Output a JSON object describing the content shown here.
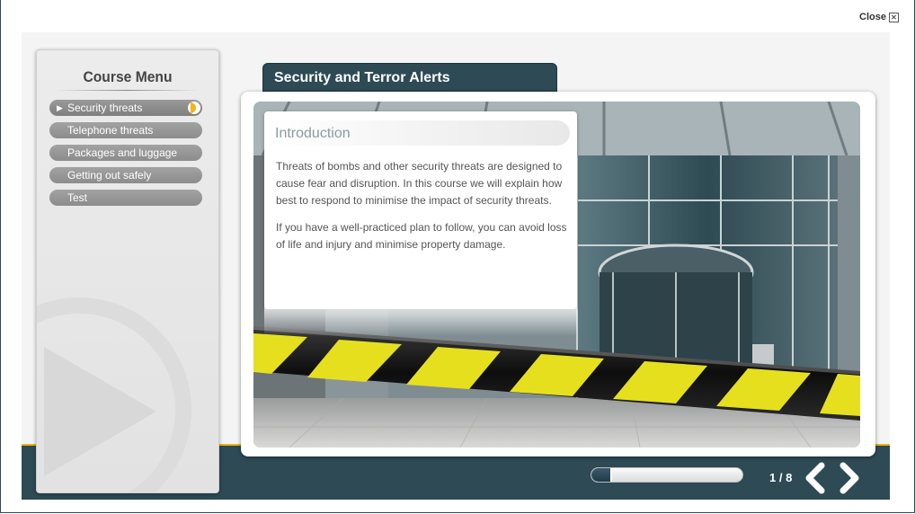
{
  "window": {
    "close_label": "Close"
  },
  "course_menu": {
    "title": "Course Menu",
    "items": [
      {
        "label": "Security threats",
        "active": true
      },
      {
        "label": "Telephone threats",
        "active": false
      },
      {
        "label": "Packages and luggage",
        "active": false
      },
      {
        "label": "Getting out safely",
        "active": false
      },
      {
        "label": "Test",
        "active": false
      }
    ]
  },
  "section": {
    "title": "Security and Terror Alerts"
  },
  "intro": {
    "title": "Introduction",
    "paragraphs": [
      "Threats of bombs and other security threats are designed to cause fear and disruption. In this course we will explain how best to respond to minimise the impact of security threats.",
      "If you have a well-practiced plan to follow, you can avoid loss of life and injury and minimise property damage."
    ]
  },
  "footer": {
    "page_label": "1 / 8",
    "progress_percent": 12.5
  },
  "colors": {
    "navy": "#2d4a55",
    "accent_yellow": "#e8b417",
    "menu_pill": "#8c8c8c"
  },
  "icons": [
    "close-icon",
    "play-arrow-icon",
    "progress-half-icon",
    "prev-chevron-icon",
    "next-chevron-icon"
  ]
}
